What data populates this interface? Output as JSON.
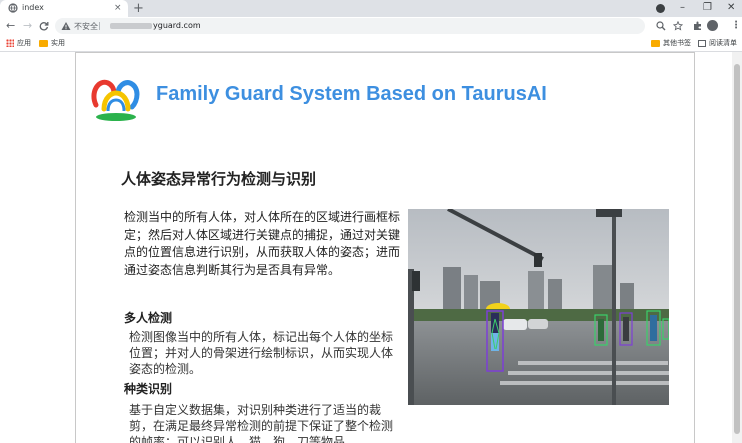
{
  "browser": {
    "tab_title": "index",
    "tab_close": "×",
    "new_tab": "+",
    "window_controls": {
      "minimize": "–",
      "restore": "❐",
      "close": "✕"
    },
    "nav": {
      "back": "←",
      "forward": "→",
      "reload": "C"
    },
    "address": {
      "security_label": "不安全",
      "separator": "|",
      "url": "yguard.com"
    },
    "toolbar_icons": [
      "zoom-icon",
      "star-icon",
      "extensions-icon",
      "profile-icon",
      "menu-icon"
    ],
    "menu_glyph": "⋮"
  },
  "bookmarks": {
    "apps_label": "应用",
    "practical_label": "实用",
    "other_bookmarks_label": "其他书签",
    "reading_list_label": "阅读清单"
  },
  "page": {
    "brand_title": "Family Guard System Based on TaurusAI",
    "section_title": "人体姿态异常行为检测与识别",
    "intro": "检测当中的所有人体，对人体所在的区域进行画框标定；然后对人体区域进行关键点的捕捉，通过对关键点的位置信息进行识别，从而获取人体的姿态；进而通过姿态信息判断其行为是否具有异常。",
    "features": [
      {
        "title": "多人检测",
        "text": "检测图像当中的所有人体，标记出每个人体的坐标位置；并对人的骨架进行绘制标识，从而实现人体姿态的检测。"
      },
      {
        "title": "种类识别",
        "text": "基于自定义数据集，对识别种类进行了适当的裁剪，在满足最终异常检测的前提下保证了整个检测的帧率；可以识别人、猫、狗、刀等物品"
      }
    ]
  },
  "colors": {
    "brand_blue": "#3d8fe0",
    "logo_red": "#e8392f",
    "logo_yellow": "#f5c400",
    "logo_blue": "#2f8de4",
    "logo_green": "#2bb24c"
  }
}
